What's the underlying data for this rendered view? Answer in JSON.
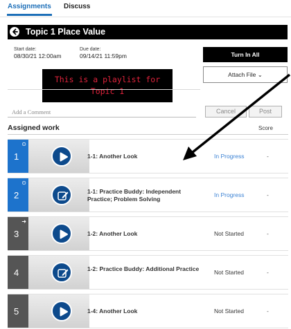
{
  "tabs": [
    {
      "label": "Assignments",
      "active": true
    },
    {
      "label": "Discuss",
      "active": false
    }
  ],
  "header": {
    "title": "Topic 1 Place Value",
    "back_icon": "back-arrow-circle-icon"
  },
  "dates": {
    "start_label": "Start date:",
    "start_value": "08/30/21 12:00am",
    "due_label": "Due date:",
    "due_value": "09/14/21 11:59pm"
  },
  "actions": {
    "turn_in_label": "Turn In All",
    "attach_label": "Attach File ⌄"
  },
  "description": {
    "line1": "This is a playlist for",
    "line2": "Topic 1"
  },
  "comment": {
    "placeholder": "Add a Comment",
    "cancel_label": "Cancel",
    "post_label": "Post"
  },
  "assigned": {
    "title": "Assigned work",
    "score_header": "Score"
  },
  "colors": {
    "blue_active": "#1d73cc",
    "gray_inactive": "#555555",
    "status_blue": "#3b82d4"
  },
  "items": [
    {
      "number": "1",
      "mark": "⊙",
      "title": "1-1: Another Look",
      "status": "In Progress",
      "score": "-",
      "type": "video"
    },
    {
      "number": "2",
      "mark": "⊙",
      "title": "1-1: Practice Buddy: Independent Practice; Problem Solving",
      "status": "In Progress",
      "score": "-",
      "type": "practice"
    },
    {
      "number": "3",
      "mark": "➜",
      "title": "1-2: Another Look",
      "status": "Not Started",
      "score": "-",
      "type": "video"
    },
    {
      "number": "4",
      "mark": "",
      "title": "1-2: Practice Buddy: Additional Practice",
      "status": "Not Started",
      "score": "-",
      "type": "practice"
    },
    {
      "number": "5",
      "mark": "",
      "title": "1-4: Another Look",
      "status": "Not Started",
      "score": "-",
      "type": "video"
    }
  ]
}
